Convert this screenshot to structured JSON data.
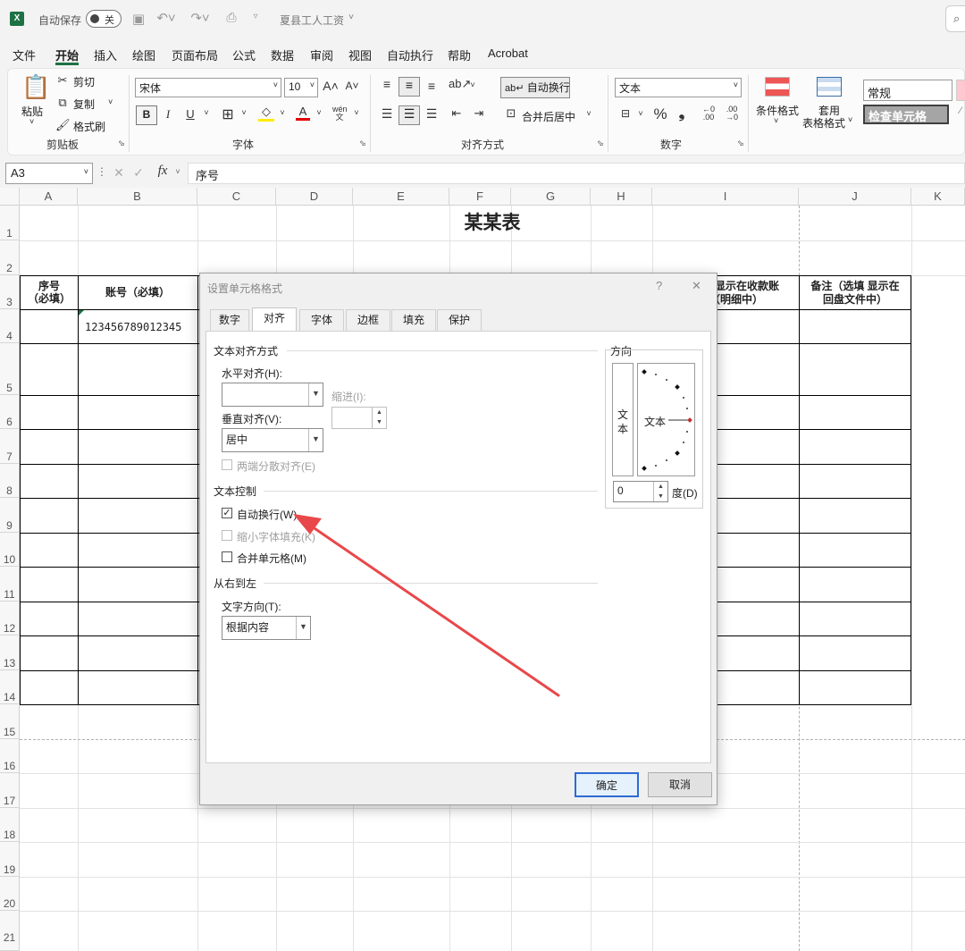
{
  "titlebar": {
    "autosave_label": "自动保存",
    "autosave_state": "关",
    "file_name": "夏县工人工资"
  },
  "menu": [
    "文件",
    "开始",
    "插入",
    "绘图",
    "页面布局",
    "公式",
    "数据",
    "审阅",
    "视图",
    "自动执行",
    "帮助",
    "Acrobat"
  ],
  "ribbon": {
    "clipboard": {
      "paste": "粘贴",
      "cut": "剪切",
      "copy": "复制",
      "format_painter": "格式刷",
      "group": "剪贴板"
    },
    "font": {
      "name": "宋体",
      "size": "10",
      "bold": "B",
      "italic": "I",
      "underline": "U",
      "group": "字体"
    },
    "alignment": {
      "wrap_text": "自动换行",
      "merge_center": "合并后居中",
      "group": "对齐方式"
    },
    "number": {
      "format": "文本",
      "percent": "%",
      "group": "数字"
    },
    "styles": {
      "conditional": "条件格式",
      "table_format_1": "套用",
      "table_format_2": "表格格式",
      "normal": "常规",
      "check_cell": "检查单元格"
    }
  },
  "formula_bar": {
    "cell_ref": "A3",
    "content": "序号"
  },
  "sheet": {
    "columns": [
      "A",
      "B",
      "C",
      "D",
      "E",
      "F",
      "G",
      "H",
      "I",
      "J",
      "K"
    ],
    "rows": [
      "1",
      "2",
      "3",
      "4",
      "5",
      "6",
      "7",
      "8",
      "9",
      "10",
      "11",
      "12",
      "13",
      "14",
      "15",
      "16",
      "17",
      "18",
      "19",
      "20",
      "21"
    ],
    "title": "某某表",
    "header_a_1": "序号",
    "header_a_2": "（必填）",
    "header_b": "账号（必填）",
    "header_i_1": "显示在收款账",
    "header_i_2": "（明细中）",
    "header_j_1": "备注（选填 显示在",
    "header_j_2": "回盘文件中）",
    "b4_value": "123456789012345"
  },
  "dialog": {
    "title": "设置单元格格式",
    "help": "?",
    "close": "✕",
    "tabs": [
      "数字",
      "对齐",
      "字体",
      "边框",
      "填充",
      "保护"
    ],
    "active_tab": "对齐",
    "text_alignment": {
      "heading": "文本对齐方式",
      "horizontal_label": "水平对齐(H):",
      "horizontal_value": "",
      "indent_label": "缩进(I):",
      "vertical_label": "垂直对齐(V):",
      "vertical_value": "居中",
      "distributed": "两端分散对齐(E)"
    },
    "text_control": {
      "heading": "文本控制",
      "wrap": "自动换行(W)",
      "wrap_checked": true,
      "shrink": "缩小字体填充(K)",
      "merge": "合并单元格(M)"
    },
    "rtl": {
      "heading": "从右到左",
      "direction_label": "文字方向(T):",
      "direction_value": "根据内容"
    },
    "orientation": {
      "heading": "方向",
      "vertical_text": "文本",
      "horizontal_text": "文本",
      "degrees": "0",
      "degrees_label": "度(D)"
    },
    "ok": "确定",
    "cancel": "取消"
  },
  "annotation": {
    "arrow_color": "#e8484a"
  }
}
